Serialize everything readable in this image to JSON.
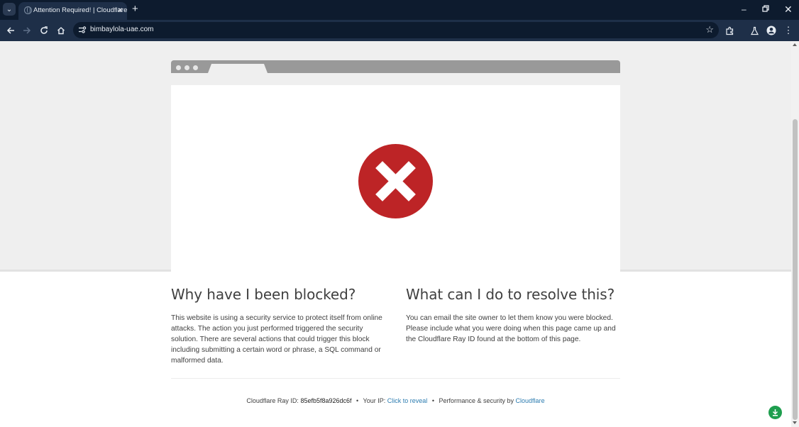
{
  "browser": {
    "tab_title": "Attention Required! | Cloudflare",
    "url": "bimbaylola-uae.com",
    "new_tab_label": "+",
    "close_tab_label": "×"
  },
  "page": {
    "left_heading": "Why have I been blocked?",
    "left_text": "This website is using a security service to protect itself from online attacks. The action you just performed triggered the security solution. There are several actions that could trigger this block including submitting a certain word or phrase, a SQL command or malformed data.",
    "right_heading": "What can I do to resolve this?",
    "right_text": "You can email the site owner to let them know you were blocked. Please include what you were doing when this page came up and the Cloudflare Ray ID found at the bottom of this page."
  },
  "footer": {
    "ray_id_label": "Cloudflare Ray ID:",
    "ray_id_value": "85efb5f8a926dc6f",
    "bullet": "•",
    "ip_label": "Your IP:",
    "ip_link": "Click to reveal",
    "perf_label": "Performance & security by",
    "perf_link": "Cloudflare"
  },
  "colors": {
    "error_red": "#bd2426",
    "link_blue": "#2c7cb0",
    "chrome_dark": "#0d1b2e",
    "chrome_toolbar": "#1e2f48"
  },
  "icons": [
    "tab-list-icon",
    "globe-icon",
    "close-icon",
    "plus-icon",
    "minimize-icon",
    "restore-icon",
    "back-arrow-icon",
    "forward-arrow-icon",
    "reload-icon",
    "home-icon",
    "site-info-icon",
    "bookmark-star-icon",
    "extensions-icon",
    "labs-flask-icon",
    "profile-avatar-icon",
    "more-menu-icon",
    "error-x-icon",
    "download-icon"
  ]
}
